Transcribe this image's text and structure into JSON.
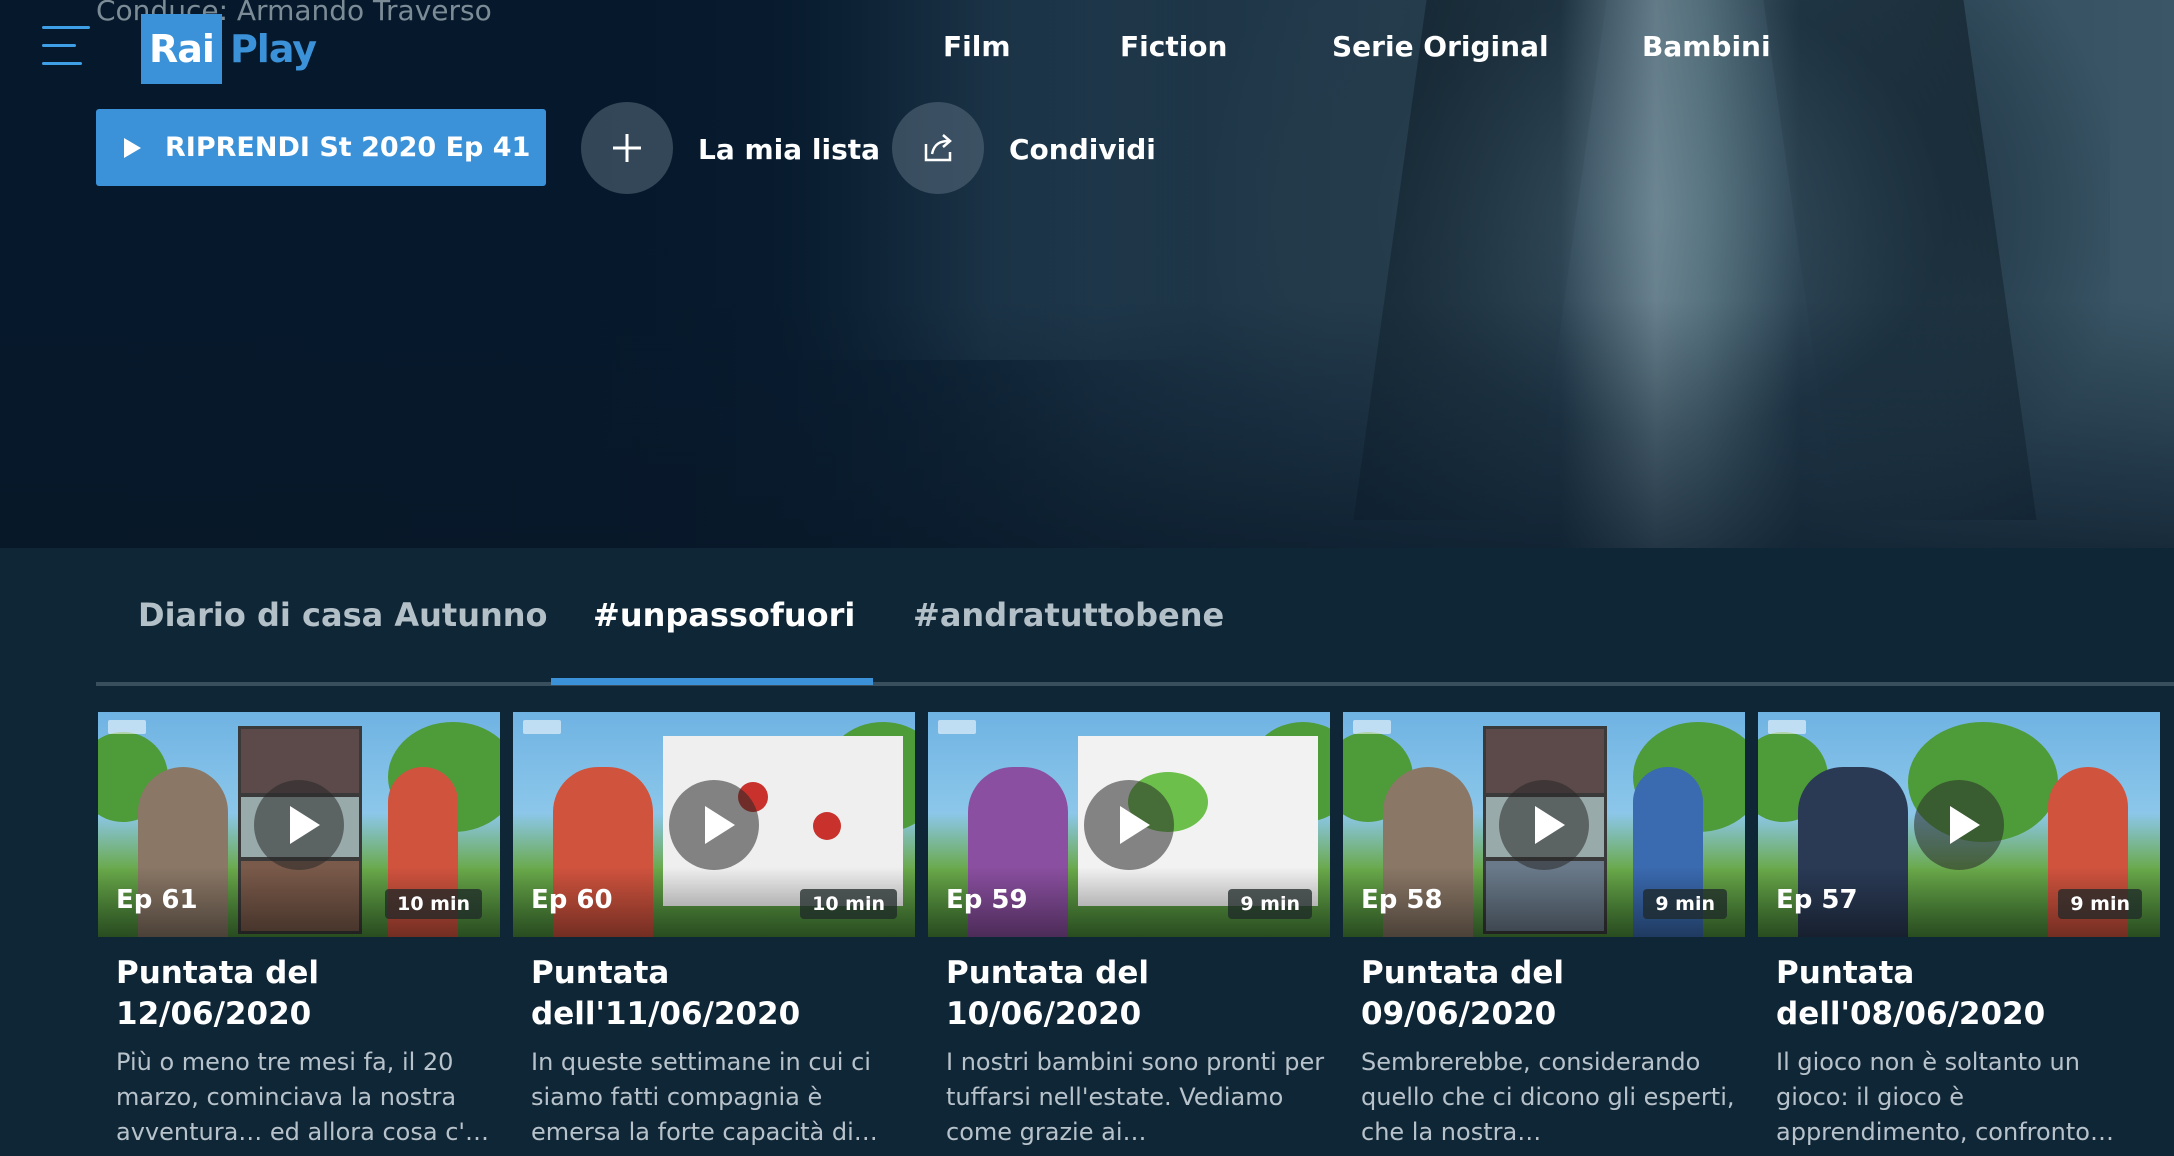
{
  "hero": {
    "top_text": "Conduce: Armando Traverso"
  },
  "logo": {
    "part1": "Rai",
    "part2": "Play"
  },
  "nav": {
    "items": [
      "Film",
      "Fiction",
      "Serie Original",
      "Bambini"
    ]
  },
  "actions": {
    "resume": "RIPRENDI St 2020 Ep 41",
    "my_list": "La mia lista",
    "share": "Condividi"
  },
  "tabs": {
    "items": [
      "Diario di casa Autunno",
      "#unpassofuori",
      "#andratuttobene"
    ],
    "active_index": 1
  },
  "episodes": [
    {
      "ep": "Ep 61",
      "duration": "10 min",
      "title": "Puntata del 12/06/2020",
      "desc": "Più o meno tre mesi fa, il 20 marzo, cominciava la nostra avventura… ed allora cosa c'…"
    },
    {
      "ep": "Ep 60",
      "duration": "10 min",
      "title": "Puntata dell'11/06/2020",
      "desc": "In queste settimane in cui ci siamo fatti compagnia è emersa la forte capacità di…"
    },
    {
      "ep": "Ep 59",
      "duration": "9 min",
      "title": "Puntata del 10/06/2020",
      "desc": "I nostri bambini sono pronti per tuffarsi nell'estate. Vediamo come grazie ai…"
    },
    {
      "ep": "Ep 58",
      "duration": "9 min",
      "title": "Puntata del 09/06/2020",
      "desc": "Sembrerebbe, considerando quello che ci dicono gli esperti, che la nostra…"
    },
    {
      "ep": "Ep 57",
      "duration": "9 min",
      "title": "Puntata dell'08/06/2020",
      "desc": "Il gioco non è soltanto un gioco: il gioco è apprendimento, confronto…"
    }
  ],
  "colors": {
    "accent": "#3b92d8",
    "background": "#0f2637",
    "hero_dark": "#06182b"
  }
}
